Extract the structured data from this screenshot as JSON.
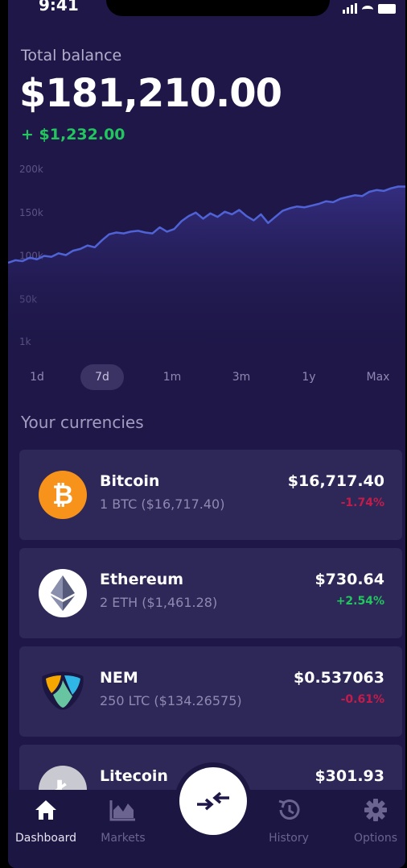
{
  "status_bar": {
    "time": "9:41"
  },
  "balance": {
    "label": "Total balance",
    "value": "$181,210.00",
    "change": "+ $1,232.00"
  },
  "chart_data": {
    "type": "area",
    "y_ticks": [
      "200k",
      "150k",
      "100k",
      "50k",
      "1k"
    ],
    "ylim": [
      1000,
      200000
    ],
    "series": [
      {
        "values": [
          92000,
          95000,
          94000,
          98000,
          96000,
          100000,
          99000,
          103000,
          101000,
          106000,
          108000,
          112000,
          110000,
          118000,
          125000,
          127000,
          126000,
          128000,
          129000,
          127000,
          126000,
          133000,
          128000,
          131000,
          140000,
          146000,
          150000,
          143000,
          149000,
          145000,
          151000,
          148000,
          153000,
          146000,
          141000,
          148000,
          138000,
          145000,
          152000,
          155000,
          157000,
          156000,
          158000,
          160000,
          163000,
          162000,
          166000,
          168000,
          170000,
          169000,
          174000,
          176000,
          175000,
          178000,
          180000,
          180000
        ]
      }
    ],
    "color": "#4f63d6",
    "grid": false
  },
  "range_tabs": [
    {
      "label": "1d"
    },
    {
      "label": "7d"
    },
    {
      "label": "1m"
    },
    {
      "label": "3m"
    },
    {
      "label": "1y"
    },
    {
      "label": "Max"
    }
  ],
  "range_selected": "7d",
  "currencies": {
    "title": "Your currencies",
    "items": [
      {
        "name": "Bitcoin",
        "holding": "1 BTC ($16,717.40)",
        "price": "$16,717.40",
        "change": "-1.74%",
        "trend": "down",
        "icon": "bitcoin-icon",
        "icon_glyph": "₿"
      },
      {
        "name": "Ethereum",
        "holding": "2 ETH ($1,461.28)",
        "price": "$730.64",
        "change": "+2.54%",
        "trend": "up",
        "icon": "ethereum-icon"
      },
      {
        "name": "NEM",
        "holding": "250 LTC ($134.26575)",
        "price": "$0.537063",
        "change": "-0.61%",
        "trend": "down",
        "icon": "nem-icon"
      },
      {
        "name": "Litecoin",
        "holding": "",
        "price": "$301.93",
        "change": "",
        "trend": "",
        "icon": "litecoin-icon"
      }
    ]
  },
  "nav": {
    "items": [
      {
        "label": "Dashboard",
        "icon": "home-icon"
      },
      {
        "label": "Markets",
        "icon": "chart-icon"
      },
      {
        "label": "History",
        "icon": "history-icon"
      },
      {
        "label": "Options",
        "icon": "gear-icon"
      }
    ],
    "active": "Dashboard",
    "center_button_icon": "exchange-icon"
  },
  "colors": {
    "background": "#1e1748",
    "card": "#2e2858",
    "positive": "#22c55e",
    "negative": "#c41c4a",
    "bitcoin": "#f7931a"
  }
}
